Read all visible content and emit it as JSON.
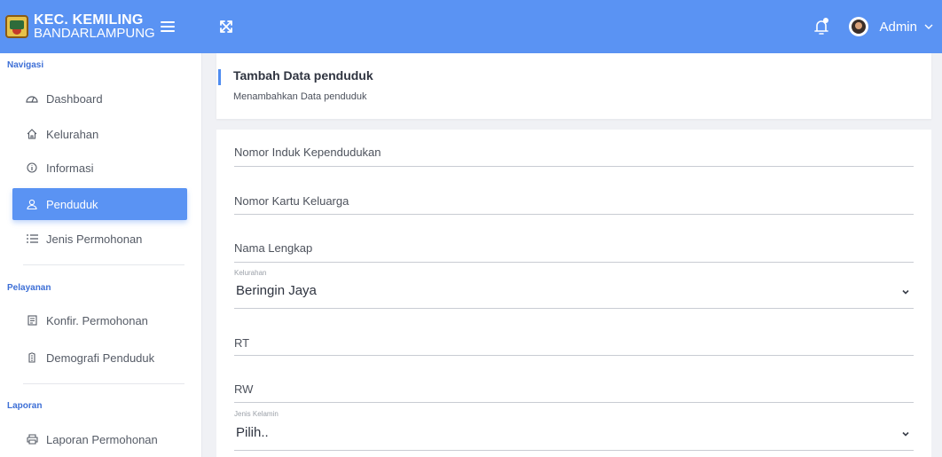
{
  "header": {
    "brand_line1": "KEC. KEMILING",
    "brand_line2": "BANDARLAMPUNG",
    "user_name": "Admin",
    "bg_color": "#5a93f3"
  },
  "sidebar": {
    "sections": [
      {
        "title": "Navigasi"
      },
      {
        "title": "Pelayanan"
      },
      {
        "title": "Laporan"
      }
    ],
    "items": [
      {
        "label": "Dashboard",
        "icon": "dashboard-icon"
      },
      {
        "label": "Kelurahan",
        "icon": "home-icon"
      },
      {
        "label": "Informasi",
        "icon": "info-icon"
      },
      {
        "label": "Penduduk",
        "icon": "user-icon",
        "active": true
      },
      {
        "label": "Jenis Permohonan",
        "icon": "list-icon"
      },
      {
        "label": "Konfir. Permohonan",
        "icon": "document-icon"
      },
      {
        "label": "Demografi Penduduk",
        "icon": "building-icon"
      },
      {
        "label": "Laporan Permohonan",
        "icon": "printer-icon"
      }
    ],
    "accent_color": "#5a93f3"
  },
  "page": {
    "title": "Tambah Data penduduk",
    "subtitle": "Menambahkan Data penduduk"
  },
  "form": {
    "nik_placeholder": "Nomor Induk Kependudukan",
    "kk_placeholder": "Nomor Kartu Keluarga",
    "nama_placeholder": "Nama Lengkap",
    "kelurahan_label": "Kelurahan",
    "kelurahan_value": "Beringin Jaya",
    "rt_placeholder": "RT",
    "rw_placeholder": "RW",
    "gender_label": "Jenis Kelamin",
    "gender_value": "Pilih.."
  }
}
